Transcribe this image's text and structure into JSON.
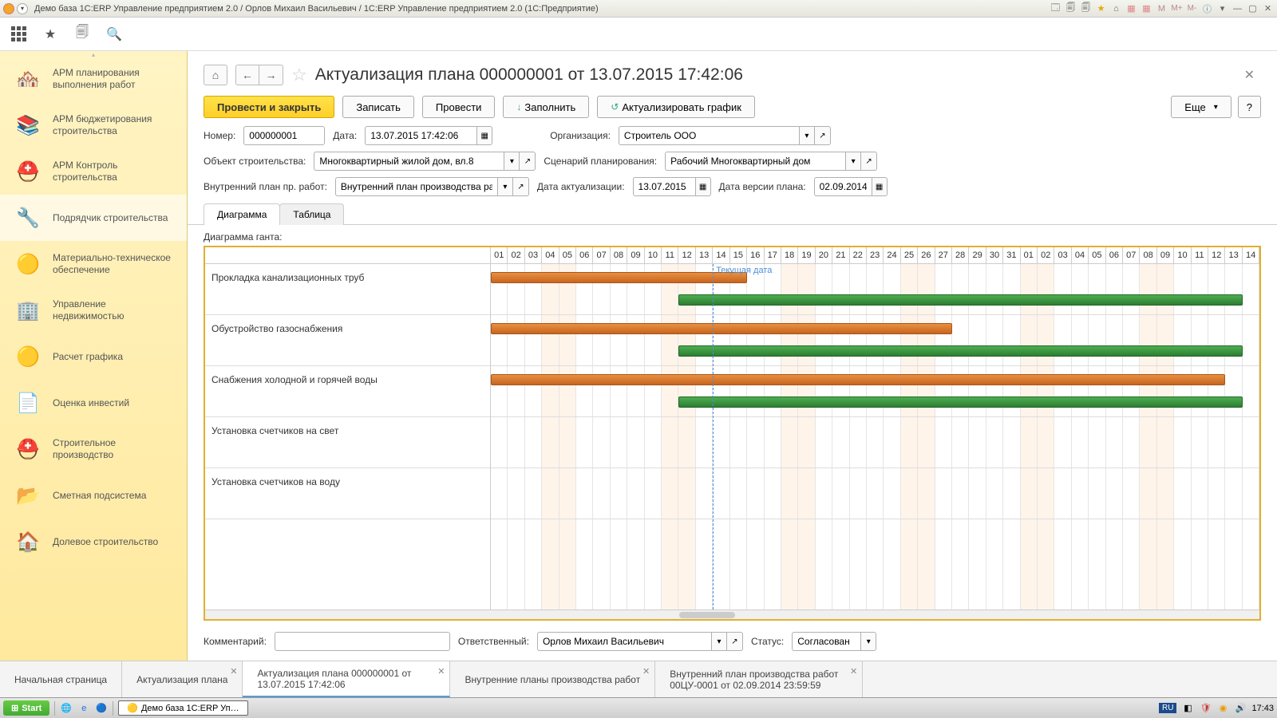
{
  "window": {
    "title": "Демо база 1C:ERP Управление предприятием 2.0 / Орлов Михаил Васильевич / 1С:ERP Управление предприятием 2.0  (1С:Предприятие)"
  },
  "sidebar": {
    "items": [
      {
        "label": "АРМ планирования выполнения работ",
        "icon": "🏘️"
      },
      {
        "label": "АРМ бюджетирования строительства",
        "icon": "📚"
      },
      {
        "label": "АРМ Контроль строительства",
        "icon": "⛑️"
      },
      {
        "label": "Подрядчик строительства",
        "icon": "🔧"
      },
      {
        "label": "Материально-техническое обеспечение",
        "icon": "🟡"
      },
      {
        "label": "Управление недвижимостью",
        "icon": "🏢"
      },
      {
        "label": "Расчет графика",
        "icon": "🟡"
      },
      {
        "label": "Оценка инвестий",
        "icon": "📄"
      },
      {
        "label": "Строительное производство",
        "icon": "⛑️"
      },
      {
        "label": "Сметная подсистема",
        "icon": "📂"
      },
      {
        "label": "Долевое строительство",
        "icon": "🏠"
      }
    ]
  },
  "document": {
    "title": "Актуализация плана 000000001 от 13.07.2015 17:42:06",
    "commands": {
      "post_close": "Провести и закрыть",
      "save": "Записать",
      "post": "Провести",
      "fill": "Заполнить",
      "refresh_chart": "Актуализировать график",
      "more": "Еще",
      "help": "?"
    },
    "fields": {
      "number_l": "Номер:",
      "number_v": "000000001",
      "date_l": "Дата:",
      "date_v": "13.07.2015 17:42:06",
      "org_l": "Организация:",
      "org_v": "Строитель ООО",
      "obj_l": "Объект строительства:",
      "obj_v": "Многоквартирный жилой дом, вл.8",
      "scen_l": "Сценарий планирования:",
      "scen_v": "Рабочий Многоквартирный дом",
      "plan_l": "Внутренний план пр. работ:",
      "plan_v": "Внутренний план производства работ",
      "actdate_l": "Дата актуализации:",
      "actdate_v": "13.07.2015",
      "verdate_l": "Дата версии плана:",
      "verdate_v": "02.09.2014",
      "comment_l": "Комментарий:",
      "comment_v": "",
      "resp_l": "Ответственный:",
      "resp_v": "Орлов Михаил Васильевич",
      "status_l": "Статус:",
      "status_v": "Согласован"
    },
    "tabs": [
      {
        "label": "Диаграмма",
        "active": true
      },
      {
        "label": "Таблица",
        "active": false
      }
    ],
    "gantt_label": "Диаграмма ганта:",
    "today_label": "Текущая дата"
  },
  "chart_data": {
    "type": "gantt",
    "time_axis": {
      "start_day": 1,
      "end_day": 44,
      "labels": [
        "01",
        "02",
        "03",
        "04",
        "05",
        "06",
        "07",
        "08",
        "09",
        "10",
        "11",
        "12",
        "13",
        "14",
        "15",
        "16",
        "17",
        "18",
        "19",
        "20",
        "21",
        "22",
        "23",
        "24",
        "25",
        "26",
        "27",
        "28",
        "29",
        "30",
        "31",
        "01",
        "02",
        "03",
        "04",
        "05",
        "06",
        "07",
        "08",
        "09",
        "10",
        "11",
        "12",
        "13",
        "14"
      ],
      "weekends": [
        4,
        5,
        11,
        12,
        18,
        19,
        25,
        26,
        32,
        33,
        39,
        40
      ]
    },
    "today": 14,
    "tasks": [
      {
        "name": "Прокладка канализационных труб",
        "bars": [
          {
            "series": "plan",
            "start": 1,
            "end": 15
          },
          {
            "series": "fact",
            "start": 12,
            "end": 44
          }
        ]
      },
      {
        "name": "Обустройство газоснабжения",
        "bars": [
          {
            "series": "plan",
            "start": 1,
            "end": 27
          },
          {
            "series": "fact",
            "start": 12,
            "end": 44
          }
        ]
      },
      {
        "name": "Снабжения холодной и горячей воды",
        "bars": [
          {
            "series": "plan",
            "start": 1,
            "end": 43
          },
          {
            "series": "fact",
            "start": 12,
            "end": 44
          }
        ]
      },
      {
        "name": "Установка счетчиков на свет",
        "bars": []
      },
      {
        "name": "Установка счетчиков на воду",
        "bars": []
      }
    ],
    "series_colors": {
      "plan": "orange",
      "fact": "green"
    }
  },
  "wintabs": [
    {
      "label": "Начальная страница",
      "closable": false
    },
    {
      "label": "Актуализация плана",
      "closable": true
    },
    {
      "label": "Актуализация плана 000000001 от 13.07.2015 17:42:06",
      "closable": true,
      "active": true
    },
    {
      "label": "Внутренние планы производства работ",
      "closable": true
    },
    {
      "label": "Внутренний план производства работ 00ЦУ-0001 от 02.09.2014 23:59:59",
      "closable": true
    }
  ],
  "taskbar": {
    "start": "Start",
    "running": "Демо база 1C:ERP Уп…",
    "lang": "RU",
    "clock": "17:43"
  }
}
